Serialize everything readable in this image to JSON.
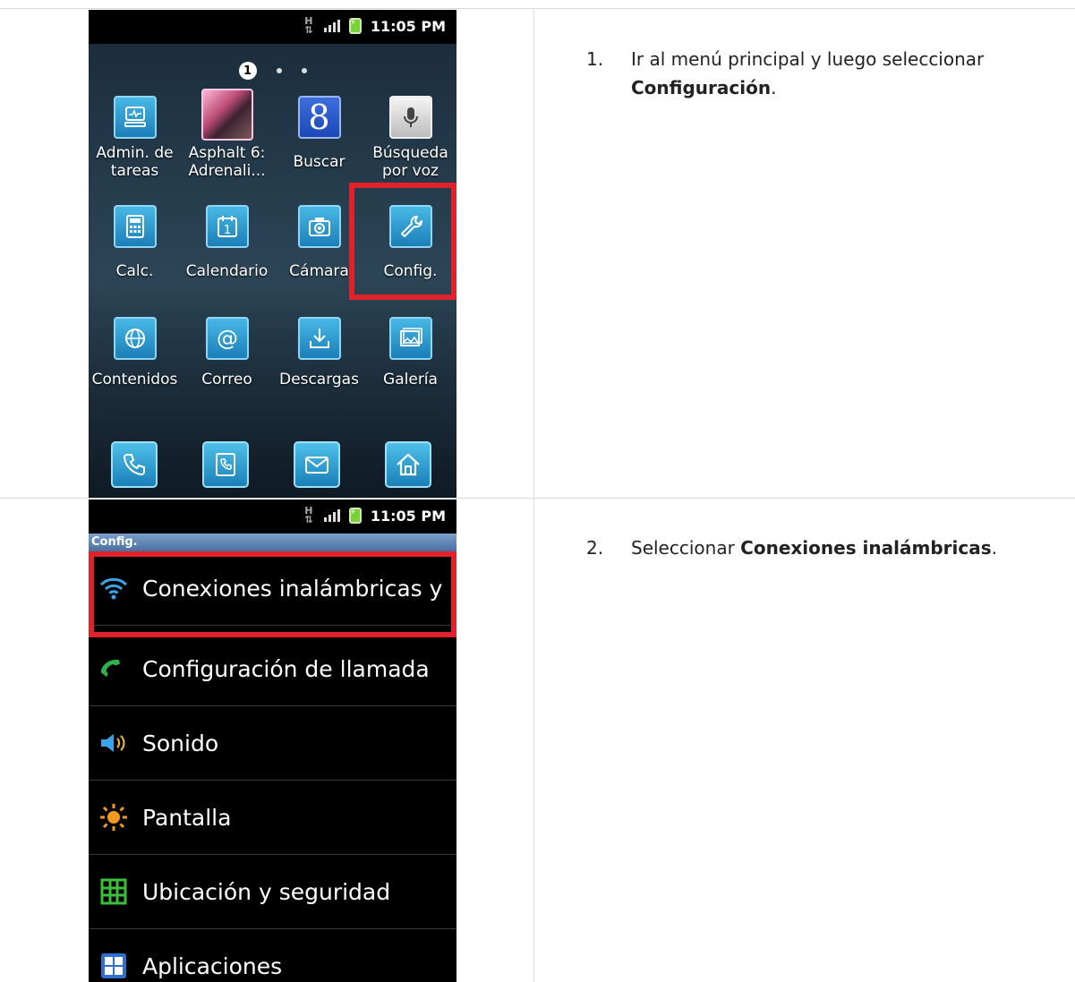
{
  "steps": [
    {
      "num": "1.",
      "text_before": "Ir al menú principal y luego seleccionar",
      "bold": "Configuración",
      "text_after": "."
    },
    {
      "num": "2.",
      "text_before": "Seleccionar",
      "bold": "Conexiones inalámbricas",
      "text_after": "."
    }
  ],
  "status_bar": {
    "network": "H",
    "time": "11:05 PM"
  },
  "home": {
    "page_indicator": "1",
    "apps": [
      {
        "label": "Admin. de\ntareas",
        "icon": "task-manager-icon"
      },
      {
        "label": "Asphalt 6:\nAdrenali...",
        "icon": "asphalt-game-icon"
      },
      {
        "label": "Buscar",
        "icon": "google-search-icon",
        "glyph": "8"
      },
      {
        "label": "Búsqueda\npor voz",
        "icon": "microphone-icon"
      },
      {
        "label": "Calc.",
        "icon": "calculator-icon"
      },
      {
        "label": "Calendario",
        "icon": "calendar-icon"
      },
      {
        "label": "Cámara",
        "icon": "camera-icon"
      },
      {
        "label": "Config.",
        "icon": "wrench-icon"
      },
      {
        "label": "Contenidos",
        "icon": "globe-icon"
      },
      {
        "label": "Correo",
        "icon": "at-sign-icon"
      },
      {
        "label": "Descargas",
        "icon": "download-icon"
      },
      {
        "label": "Galería",
        "icon": "gallery-icon"
      }
    ],
    "dock": [
      "phone-icon",
      "contacts-icon",
      "messages-icon",
      "home-icon"
    ]
  },
  "settings": {
    "header": "Config.",
    "items": [
      {
        "label": "Conexiones inalámbricas y",
        "icon": "wifi-icon"
      },
      {
        "label": "Configuración de llamada",
        "icon": "phone-handset-icon"
      },
      {
        "label": "Sonido",
        "icon": "speaker-icon"
      },
      {
        "label": "Pantalla",
        "icon": "brightness-icon"
      },
      {
        "label": "Ubicación y seguridad",
        "icon": "location-grid-icon"
      },
      {
        "label": "Aplicaciones",
        "icon": "apps-grid-icon"
      }
    ]
  },
  "colors": {
    "highlight": "#e0232b",
    "icon_blue": "#1b7fb8"
  }
}
